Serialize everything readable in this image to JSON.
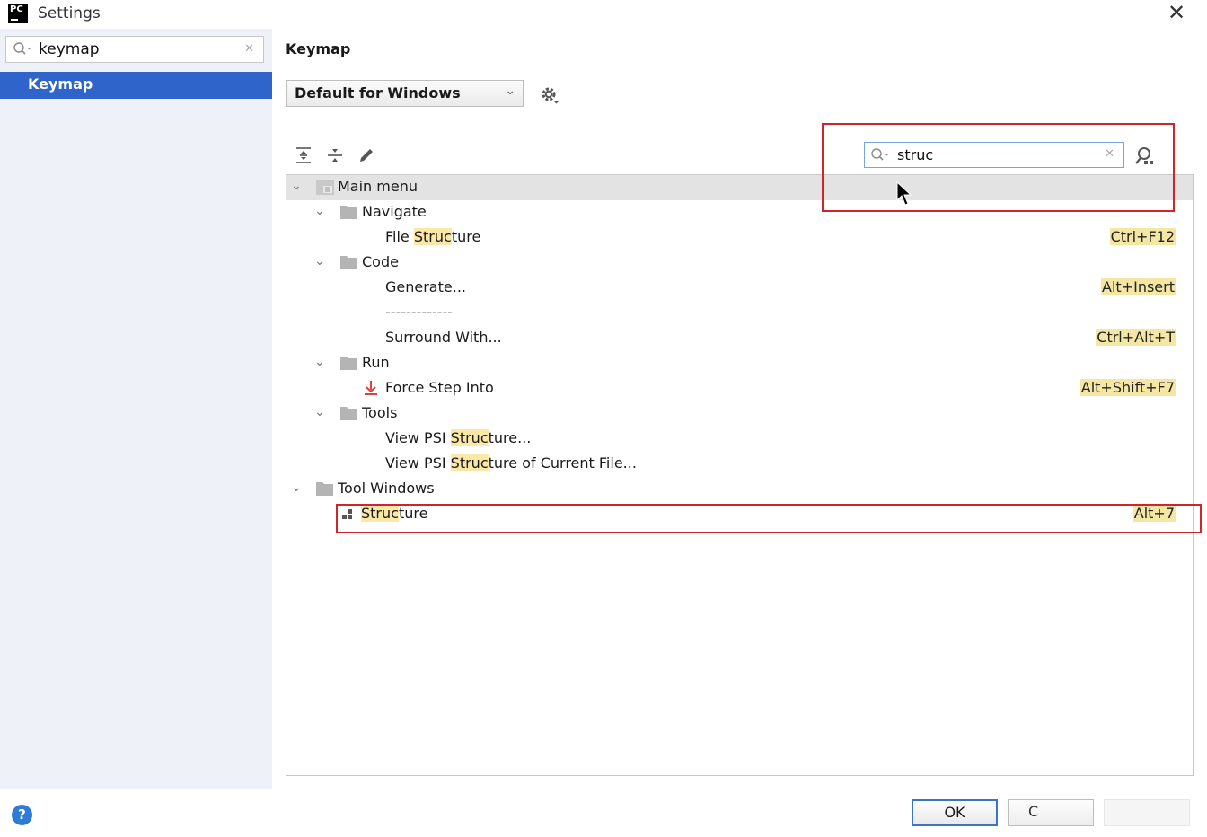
{
  "window": {
    "title": "Settings",
    "logo_text": "PC"
  },
  "sidebar": {
    "search_value": "keymap",
    "items": [
      {
        "label": "Keymap"
      }
    ]
  },
  "main": {
    "title": "Keymap",
    "scheme_value": "Default for Windows",
    "search_value": "struc",
    "tree": [
      {
        "label_pre": "Main menu",
        "label_hl": "",
        "label_post": "",
        "shortcut": ""
      },
      {
        "label_pre": "Navigate",
        "label_hl": "",
        "label_post": "",
        "shortcut": ""
      },
      {
        "label_pre": "File ",
        "label_hl": "Struc",
        "label_post": "ture",
        "shortcut": "Ctrl+F12"
      },
      {
        "label_pre": "Code",
        "label_hl": "",
        "label_post": "",
        "shortcut": ""
      },
      {
        "label_pre": "Generate...",
        "label_hl": "",
        "label_post": "",
        "shortcut": "Alt+Insert"
      },
      {
        "label_pre": "-------------",
        "label_hl": "",
        "label_post": "",
        "shortcut": ""
      },
      {
        "label_pre": "Surround With...",
        "label_hl": "",
        "label_post": "",
        "shortcut": "Ctrl+Alt+T"
      },
      {
        "label_pre": "Run",
        "label_hl": "",
        "label_post": "",
        "shortcut": ""
      },
      {
        "label_pre": "Force Step Into",
        "label_hl": "",
        "label_post": "",
        "shortcut": "Alt+Shift+F7"
      },
      {
        "label_pre": "Tools",
        "label_hl": "",
        "label_post": "",
        "shortcut": ""
      },
      {
        "label_pre": "View PSI ",
        "label_hl": "Struc",
        "label_post": "ture...",
        "shortcut": ""
      },
      {
        "label_pre": "View PSI ",
        "label_hl": "Struc",
        "label_post": "ture of Current File...",
        "shortcut": ""
      },
      {
        "label_pre": "Tool Windows",
        "label_hl": "",
        "label_post": "",
        "shortcut": ""
      },
      {
        "label_pre": "",
        "label_hl": "Struc",
        "label_post": "ture",
        "shortcut": "Alt+7"
      }
    ]
  },
  "footer": {
    "help_label": "?",
    "ok_label": "OK",
    "cancel_label": "C"
  },
  "colors": {
    "selection": "#2f65ca",
    "highlight": "#fbe7a6",
    "annotation": "#d0232a"
  },
  "icons": [
    "search-icon",
    "clear-icon",
    "chevron-down-icon",
    "gear-icon",
    "expand-all-icon",
    "collapse-all-icon",
    "edit-icon",
    "find-shortcut-icon",
    "folder-icon",
    "menu-icon",
    "step-into-icon",
    "structure-icon",
    "close-icon",
    "help-icon"
  ]
}
